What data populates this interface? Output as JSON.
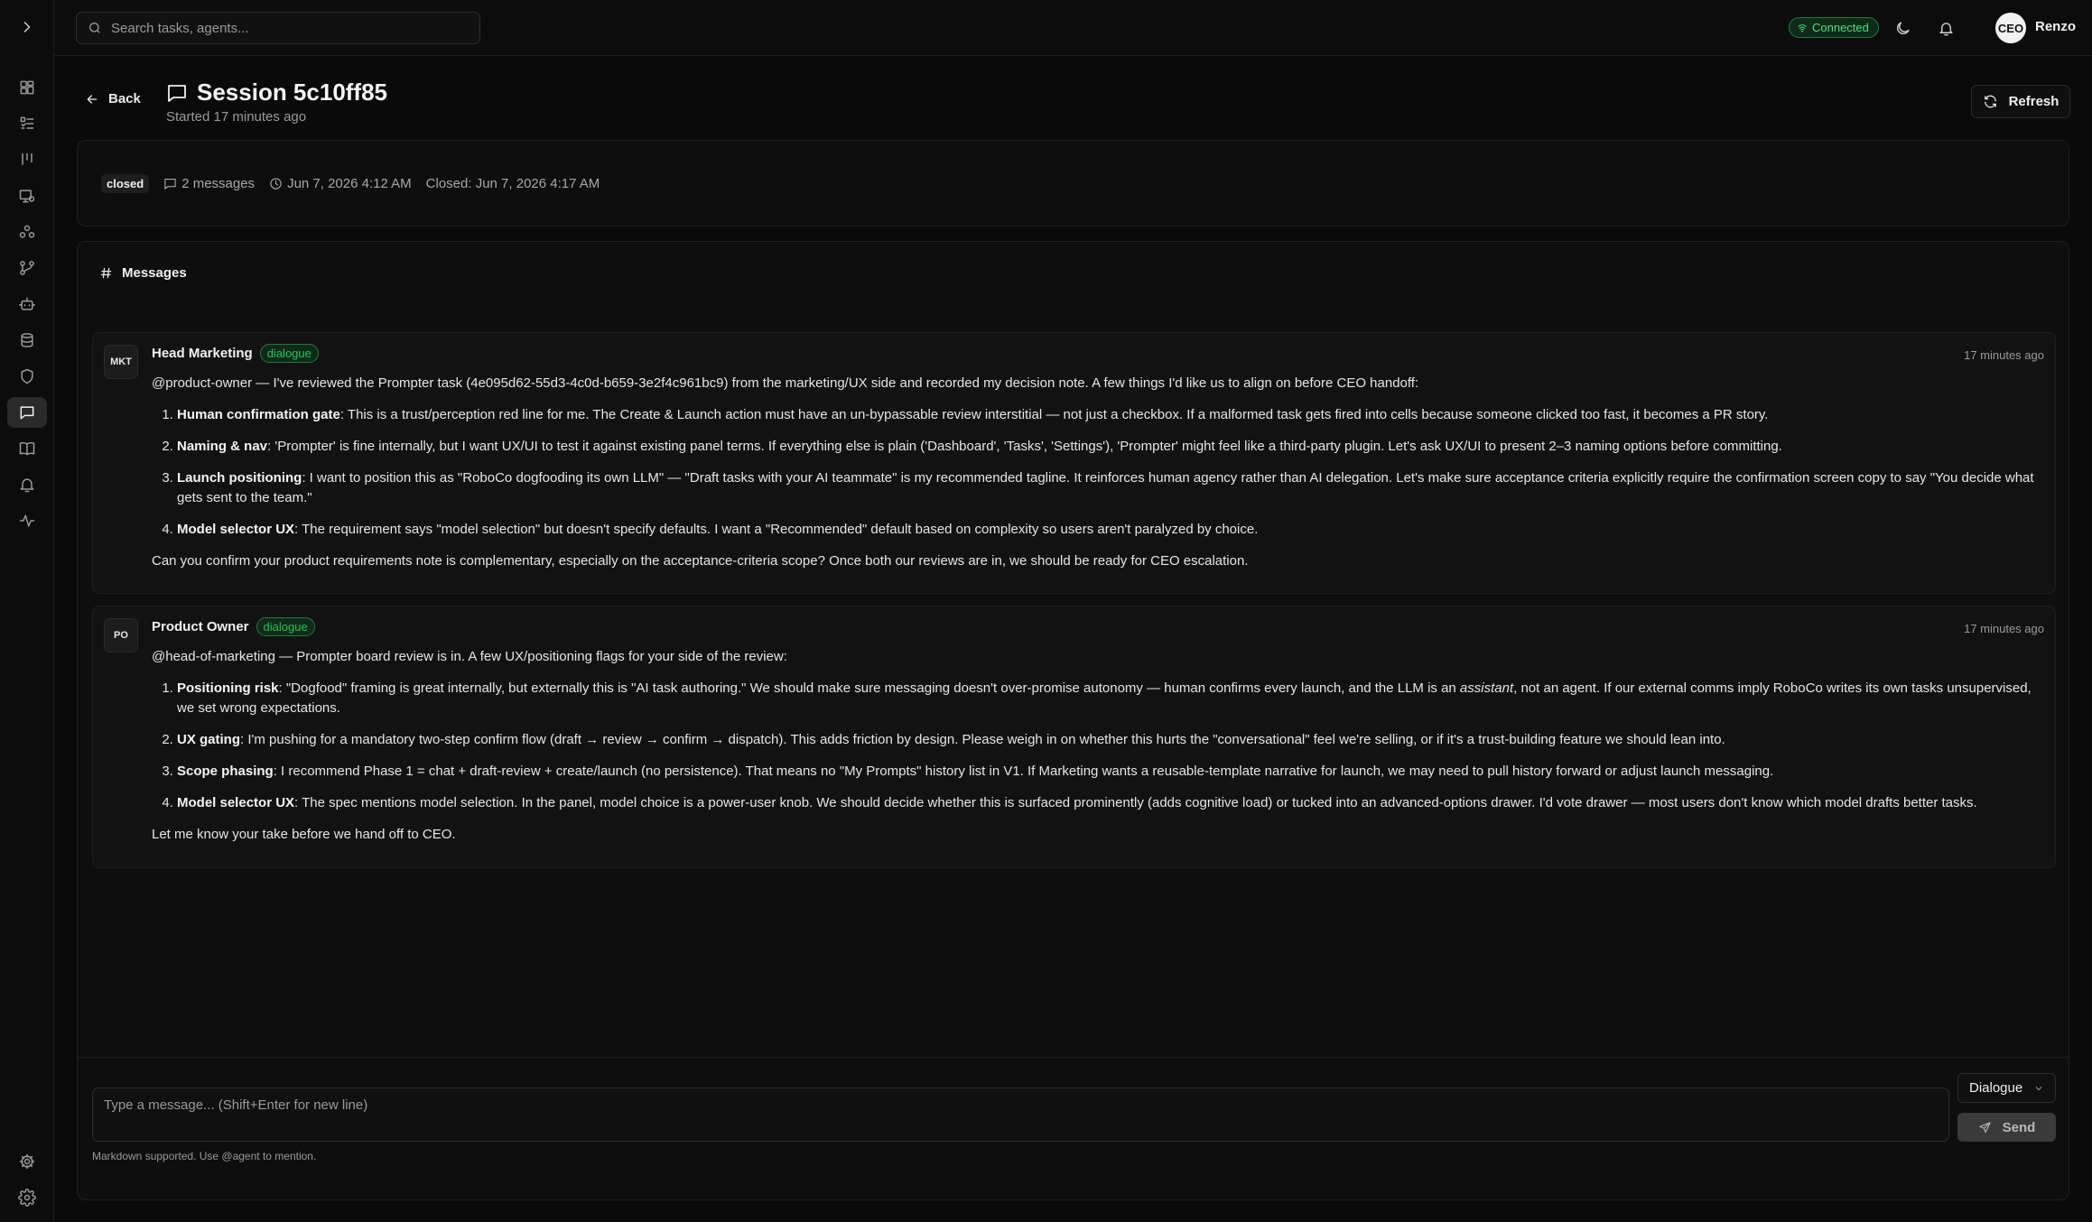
{
  "search": {
    "placeholder": "Search tasks, agents..."
  },
  "topbar": {
    "status": "Connected",
    "status_color": "#4ade80",
    "avatar_initials": "CEO",
    "user_name": "Renzo"
  },
  "sidebar": {
    "items": [
      {
        "name": "dashboard-icon"
      },
      {
        "name": "tasks-icon"
      },
      {
        "name": "board-icon"
      },
      {
        "name": "agents-icon"
      },
      {
        "name": "teams-icon"
      },
      {
        "name": "workflows-icon"
      },
      {
        "name": "bot-icon"
      },
      {
        "name": "database-icon"
      },
      {
        "name": "shield-icon"
      },
      {
        "name": "message-icon",
        "active": true
      },
      {
        "name": "book-icon"
      },
      {
        "name": "bell-icon"
      },
      {
        "name": "activity-icon"
      },
      {
        "name": "cog-icon"
      },
      {
        "name": "settings-icon"
      }
    ]
  },
  "header": {
    "back_label": "Back",
    "title": "Session 5c10ff85",
    "subtitle": "Started 17 minutes ago",
    "refresh_label": "Refresh"
  },
  "meta": {
    "status": "closed",
    "message_count": "2 messages",
    "started": "Jun 7, 2026 4:12 AM",
    "closed": "Closed: Jun 7, 2026 4:17 AM"
  },
  "messages_title": "Messages",
  "messages": [
    {
      "avatar": "MKT",
      "name": "Head Marketing",
      "badge": "dialogue",
      "time": "17 minutes ago",
      "intro": "@product-owner — I've reviewed the Prompter task (4e095d62-55d3-4c0d-b659-3e2f4c961bc9) from the marketing/UX side and recorded my decision note. A few things I'd like us to align on before CEO handoff:",
      "items": [
        {
          "title": "Human confirmation gate",
          "text": ": This is a trust/perception red line for me. The Create & Launch action must have an un-bypassable review interstitial — not just a checkbox. If a malformed task gets fired into cells because someone clicked too fast, it becomes a PR story."
        },
        {
          "title": "Naming & nav",
          "text": ": 'Prompter' is fine internally, but I want UX/UI to test it against existing panel terms. If everything else is plain ('Dashboard', 'Tasks', 'Settings'), 'Prompter' might feel like a third-party plugin. Let's ask UX/UI to present 2–3 naming options before committing."
        },
        {
          "title": "Launch positioning",
          "text": ": I want to position this as \"RoboCo dogfooding its own LLM\" — \"Draft tasks with your AI teammate\" is my recommended tagline. It reinforces human agency rather than AI delegation. Let's make sure acceptance criteria explicitly require the confirmation screen copy to say \"You decide what gets sent to the team.\""
        },
        {
          "title": "Model selector UX",
          "text": ": The requirement says \"model selection\" but doesn't specify defaults. I want a \"Recommended\" default based on complexity so users aren't paralyzed by choice."
        }
      ],
      "outro": "Can you confirm your product requirements note is complementary, especially on the acceptance-criteria scope? Once both our reviews are in, we should be ready for CEO escalation."
    },
    {
      "avatar": "PO",
      "name": "Product Owner",
      "badge": "dialogue",
      "time": "17 minutes ago",
      "intro": "@head-of-marketing — Prompter board review is in. A few UX/positioning flags for your side of the review:",
      "items": [
        {
          "title": "Positioning risk",
          "text_before": ": \"Dogfood\" framing is great internally, but externally this is \"AI task authoring.\" We should make sure messaging doesn't over-promise autonomy — human confirms every launch, and the LLM is an ",
          "emphasis": "assistant",
          "text_after": ", not an agent. If our external comms imply RoboCo writes its own tasks unsupervised, we set wrong expectations."
        },
        {
          "title": "UX gating",
          "text": ": I'm pushing for a mandatory two-step confirm flow (draft → review → confirm → dispatch). This adds friction by design. Please weigh in on whether this hurts the \"conversational\" feel we're selling, or if it's a trust-building feature we should lean into."
        },
        {
          "title": "Scope phasing",
          "text": ": I recommend Phase 1 = chat + draft-review + create/launch (no persistence). That means no \"My Prompts\" history list in V1. If Marketing wants a reusable-template narrative for launch, we may need to pull history forward or adjust launch messaging."
        },
        {
          "title": "Model selector UX",
          "text": ": The spec mentions model selection. In the panel, model choice is a power-user knob. We should decide whether this is surfaced prominently (adds cognitive load) or tucked into an advanced-options drawer. I'd vote drawer — most users don't know which model drafts better tasks."
        }
      ],
      "outro": "Let me know your take before we hand off to CEO."
    }
  ],
  "composer": {
    "placeholder": "Type a message... (Shift+Enter for new line)",
    "mode": "Dialogue",
    "send_label": "Send",
    "hint": "Markdown supported. Use @agent to mention."
  }
}
